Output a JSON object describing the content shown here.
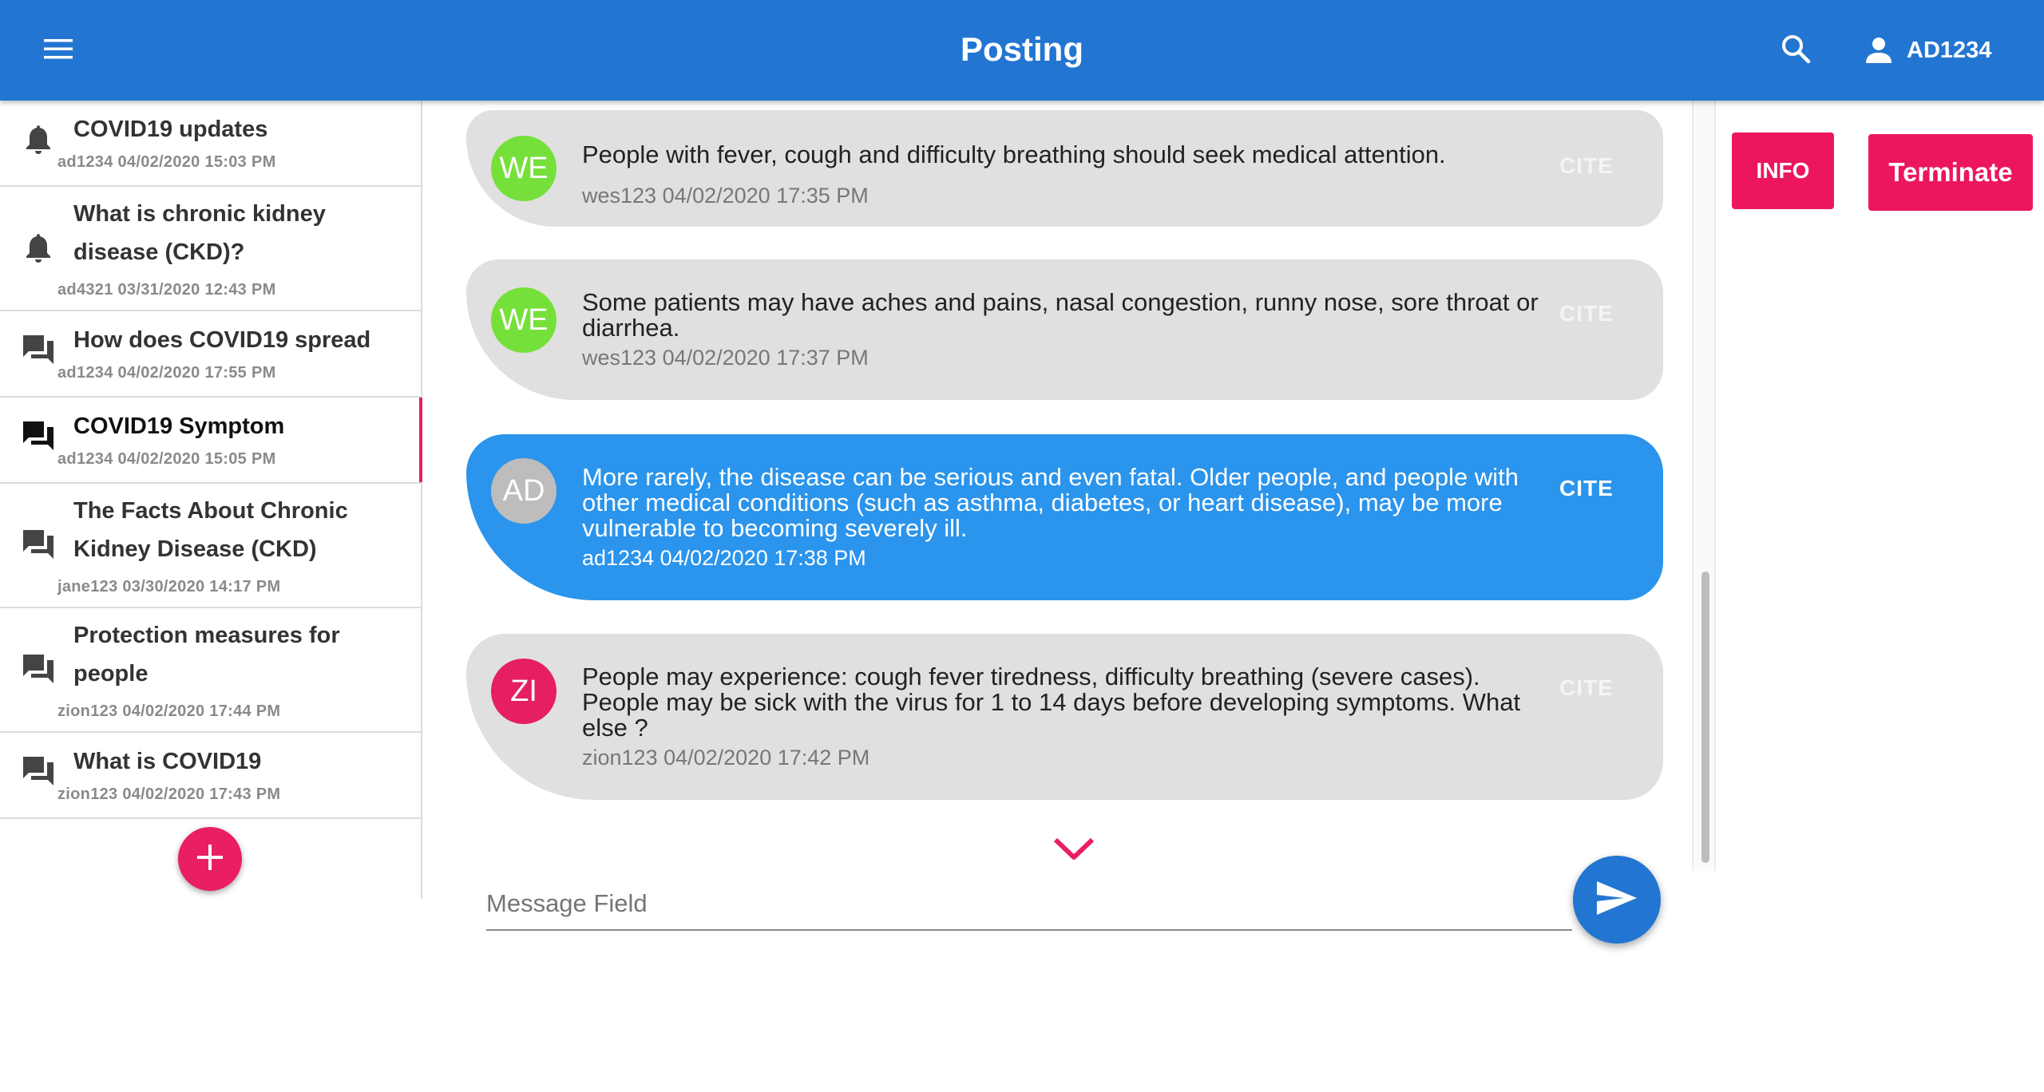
{
  "header": {
    "title": "Posting",
    "username": "AD1234",
    "menu_icon": "menu-icon",
    "search_icon": "search-icon",
    "user_icon": "person-icon"
  },
  "sidebar": {
    "threads": [
      {
        "icon": "bell-icon",
        "title": "COVID19 updates",
        "meta": "ad1234 04/02/2020 15:03 PM"
      },
      {
        "icon": "bell-icon",
        "title": "What is chronic kidney disease (CKD)?",
        "meta": "ad4321 03/31/2020 12:43 PM"
      },
      {
        "icon": "forum-icon",
        "title": "How does COVID19 spread",
        "meta": "ad1234 04/02/2020 17:55 PM"
      },
      {
        "icon": "forum-icon",
        "title": "COVID19 Symptom",
        "meta": "ad1234 04/02/2020 15:05 PM",
        "active": true
      },
      {
        "icon": "forum-icon",
        "title": "The Facts About Chronic Kidney Disease (CKD)",
        "meta": "jane123 03/30/2020 14:17 PM"
      },
      {
        "icon": "forum-icon",
        "title": "Protection measures for people",
        "meta": "zion123 04/02/2020 17:44 PM"
      },
      {
        "icon": "forum-icon",
        "title": "What is COVID19",
        "meta": "zion123 04/02/2020 17:43 PM"
      }
    ],
    "add_icon": "plus-icon"
  },
  "messages": [
    {
      "avatar": "WE",
      "avatar_color": "#76e03a",
      "text": "People with fever, cough and difficulty breathing should seek medical attention.",
      "meta": "wes123 04/02/2020 17:35 PM",
      "cite": "CITE"
    },
    {
      "avatar": "WE",
      "avatar_color": "#76e03a",
      "text": "Some patients may have aches and pains, nasal congestion, runny nose, sore throat or diarrhea.",
      "meta": "wes123 04/02/2020 17:37 PM",
      "cite": "CITE"
    },
    {
      "avatar": "AD",
      "avatar_color": "#bdbdbd",
      "text": "More rarely, the disease can be serious and even fatal. Older people, and people with other medical conditions (such as asthma, diabetes, or heart disease), may be more vulnerable to becoming severely ill.",
      "meta": "ad1234 04/02/2020 17:38 PM",
      "cite": "CITE",
      "mine": true
    },
    {
      "avatar": "ZI",
      "avatar_color": "#e61e63",
      "text": "People may experience: cough fever tiredness, difficulty breathing (severe cases). People may be sick with the virus for 1 to 14 days before developing symptoms. What else ?",
      "meta": "zion123 04/02/2020 17:42 PM",
      "cite": "CITE"
    }
  ],
  "composer": {
    "placeholder": "Message Field",
    "value": "",
    "send_icon": "send-icon",
    "scroll_icon": "chevron-down-icon"
  },
  "actions": {
    "info_label": "INFO",
    "terminate_label": "Terminate"
  },
  "colors": {
    "primary": "#2276d2",
    "accent": "#ec1660",
    "own_bubble": "#2b94ec",
    "other_bubble": "#e0e0e0"
  }
}
